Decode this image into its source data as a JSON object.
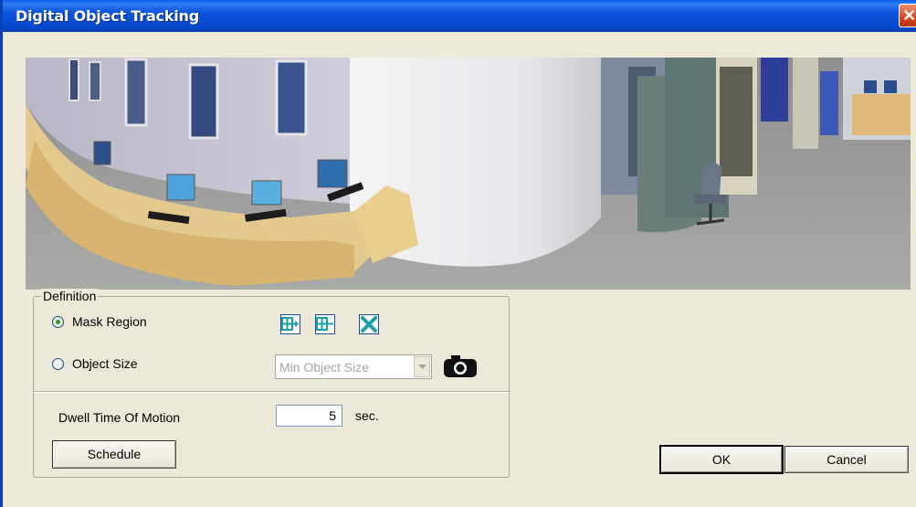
{
  "window": {
    "title": "Digital Object Tracking",
    "close_label": "✕"
  },
  "definition": {
    "legend": "Definition",
    "mask_region_label": "Mask Region",
    "object_size_label": "Object Size",
    "selected": "mask_region",
    "object_size_select": {
      "value": "Min Object Size",
      "disabled": true
    },
    "mask_tools": [
      "add-region-icon",
      "remove-region-icon",
      "clear-region-icon"
    ]
  },
  "dwell": {
    "label": "Dwell Time Of Motion",
    "value": "5",
    "unit": "sec."
  },
  "buttons": {
    "schedule": "Schedule",
    "ok": "OK",
    "cancel": "Cancel"
  },
  "colors": {
    "titlebar": "#0a54dc",
    "dialog_bg": "#ece9d8",
    "tool_icon": "#1bb0b0"
  }
}
